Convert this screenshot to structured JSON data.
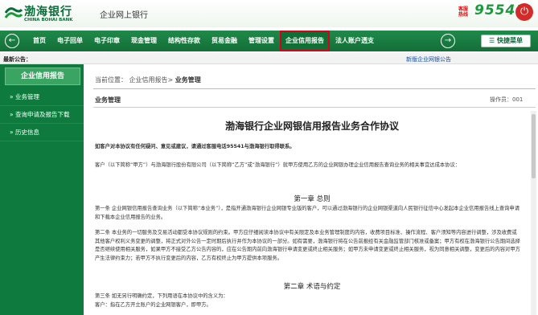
{
  "header": {
    "logo_cn": "渤海银行",
    "logo_en": "CHINA BOHAI BANK",
    "site_title": "企业网上银行",
    "hotline_label_1": "客服",
    "hotline_label_2": "热线",
    "hotline_number": "95541",
    "power_icon": "power-icon"
  },
  "nav": {
    "items": [
      {
        "label": "首页"
      },
      {
        "label": "电子回单"
      },
      {
        "label": "电子印章"
      },
      {
        "label": "现金管理"
      },
      {
        "label": "结构性存款"
      },
      {
        "label": "贸易金融"
      },
      {
        "label": "管理设置"
      },
      {
        "label": "企业信用报告",
        "active": true
      },
      {
        "label": "法人账户透支"
      }
    ],
    "quick_menu": "快捷菜单",
    "prev_icon": "arrow-left-icon",
    "next_icon": "arrow-right-icon"
  },
  "notice": {
    "label": "最新公告：",
    "link": "新版企业网银公告"
  },
  "sidebar": {
    "title": "企业信用报告",
    "items": [
      {
        "label": "业务管理"
      },
      {
        "label": "查询申请及报告下载"
      },
      {
        "label": "历史信息"
      }
    ]
  },
  "main": {
    "breadcrumb_prefix": "当前位置：",
    "breadcrumb_link": "企业信用报告>",
    "breadcrumb_current": "业务管理",
    "panel_title": "业务管理",
    "operator_id": "操作员：001",
    "doc": {
      "title": "渤海银行企业网银信用报告业务合作协议",
      "notice": "如客户对本协议有任何疑问、意见或建议，请通过客服电话95541与渤海银行取得联系。",
      "intro": "客户（以下简称“甲方”）与渤海银行股份有限公司（以下简称“乙方”或“渤海银行”）就甲方使用乙方的企业网银办理企业信用报告查询业务的相关事宜达成本协议：",
      "chapter1": "第一章  总则",
      "art1": "第一条  企业网银信用报告查询业务（以下简称“本业务”），是指开通渤海银行企业网银专业版的客户，可以通过渤海银行的企业网银渠道向人民银行征信中心发起本企业信用报告线上查询申请和下载本企业信用报告的业务。",
      "art2": "第二条  本业务的一切服务及交易活动都受本协议规则的约束。甲方应仔细阅读本协议中有关限定及本业务管理制度的内容，收费项目标准、操作流程、客户须知等内容进行调整，涉及收费或其他客户权利义务变更的调整，将正式对外公告一定时期后执行并作为本协议的一部分。如有需要，渤海银行将在公告前报经有关金融监管部门核准或备案；甲方有权在渤海银行公告期间选择是否继续使用相关服务，如果甲方不接受乙方公告内容的，应在公告期内前向渤海银行申请变更或终止相关服务；如甲方未申请变更或终止相关服务，视为同意相关调整，变更后的内容对甲方产生法律约束力；若甲方不执行变更后的内容，乙方有权终止为甲方提供本项服务。",
      "chapter2": "第二章  术语与约定",
      "art3": "第三条  如无另行明确约定，下列用语在本协议中的含义为：",
      "term1": "客户：指在乙方开立账户的企业网银客户，即甲方。"
    }
  }
}
